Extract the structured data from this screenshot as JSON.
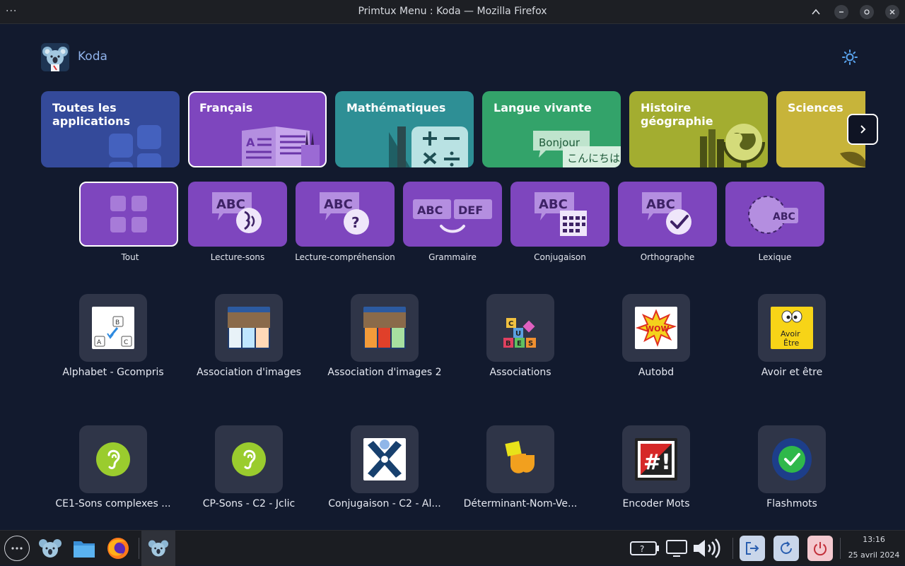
{
  "window": {
    "title": "Primtux Menu : Koda — Mozilla Firefox"
  },
  "header": {
    "profile_name": "Koda"
  },
  "categories": [
    {
      "label": "Toutes les applications",
      "color": "#344a9a"
    },
    {
      "label": "Français",
      "color": "#7e46be"
    },
    {
      "label": "Mathématiques",
      "color": "#2e8f95"
    },
    {
      "label": "Langue vivante",
      "color": "#33a36a",
      "art_words": [
        "Bonjour",
        "こんにちは"
      ]
    },
    {
      "label": "Histoire géographie",
      "color": "#a3ad30"
    },
    {
      "label": "Sciences",
      "color": "#c7b43a"
    }
  ],
  "subcategories": [
    {
      "label": "Tout",
      "art": "ABC"
    },
    {
      "label": "Lecture-sons",
      "art": "ABC"
    },
    {
      "label": "Lecture-compréhension",
      "art": "ABC"
    },
    {
      "label": "Grammaire",
      "art": "ABC",
      "art2": "DEF"
    },
    {
      "label": "Conjugaison",
      "art": "ABC"
    },
    {
      "label": "Orthographe",
      "art": "ABC"
    },
    {
      "label": "Lexique",
      "art": "ABC"
    }
  ],
  "apps": [
    {
      "label": "Alphabet - Gcompris",
      "icon_letters": [
        "B",
        "A",
        "C"
      ]
    },
    {
      "label": "Association d'images"
    },
    {
      "label": "Association d'images 2"
    },
    {
      "label": "Associations",
      "icon_letters": [
        "C",
        "U",
        "B",
        "E",
        "S"
      ]
    },
    {
      "label": "Autobd",
      "icon_text": "WOW"
    },
    {
      "label": "Avoir et être",
      "icon_text": [
        "Avoir",
        "Être"
      ]
    },
    {
      "label": "CE1-Sons complexes ..."
    },
    {
      "label": "CP-Sons - C2 - Jclic"
    },
    {
      "label": "Conjugaison - C2 - Al..."
    },
    {
      "label": "Déterminant-Nom-Ve..."
    },
    {
      "label": "Encoder Mots",
      "icon_text": "#!"
    },
    {
      "label": "Flashmots"
    }
  ],
  "tray": {
    "battery_text": "?"
  },
  "clock": {
    "time": "13:16",
    "date": "25 avril 2024"
  }
}
